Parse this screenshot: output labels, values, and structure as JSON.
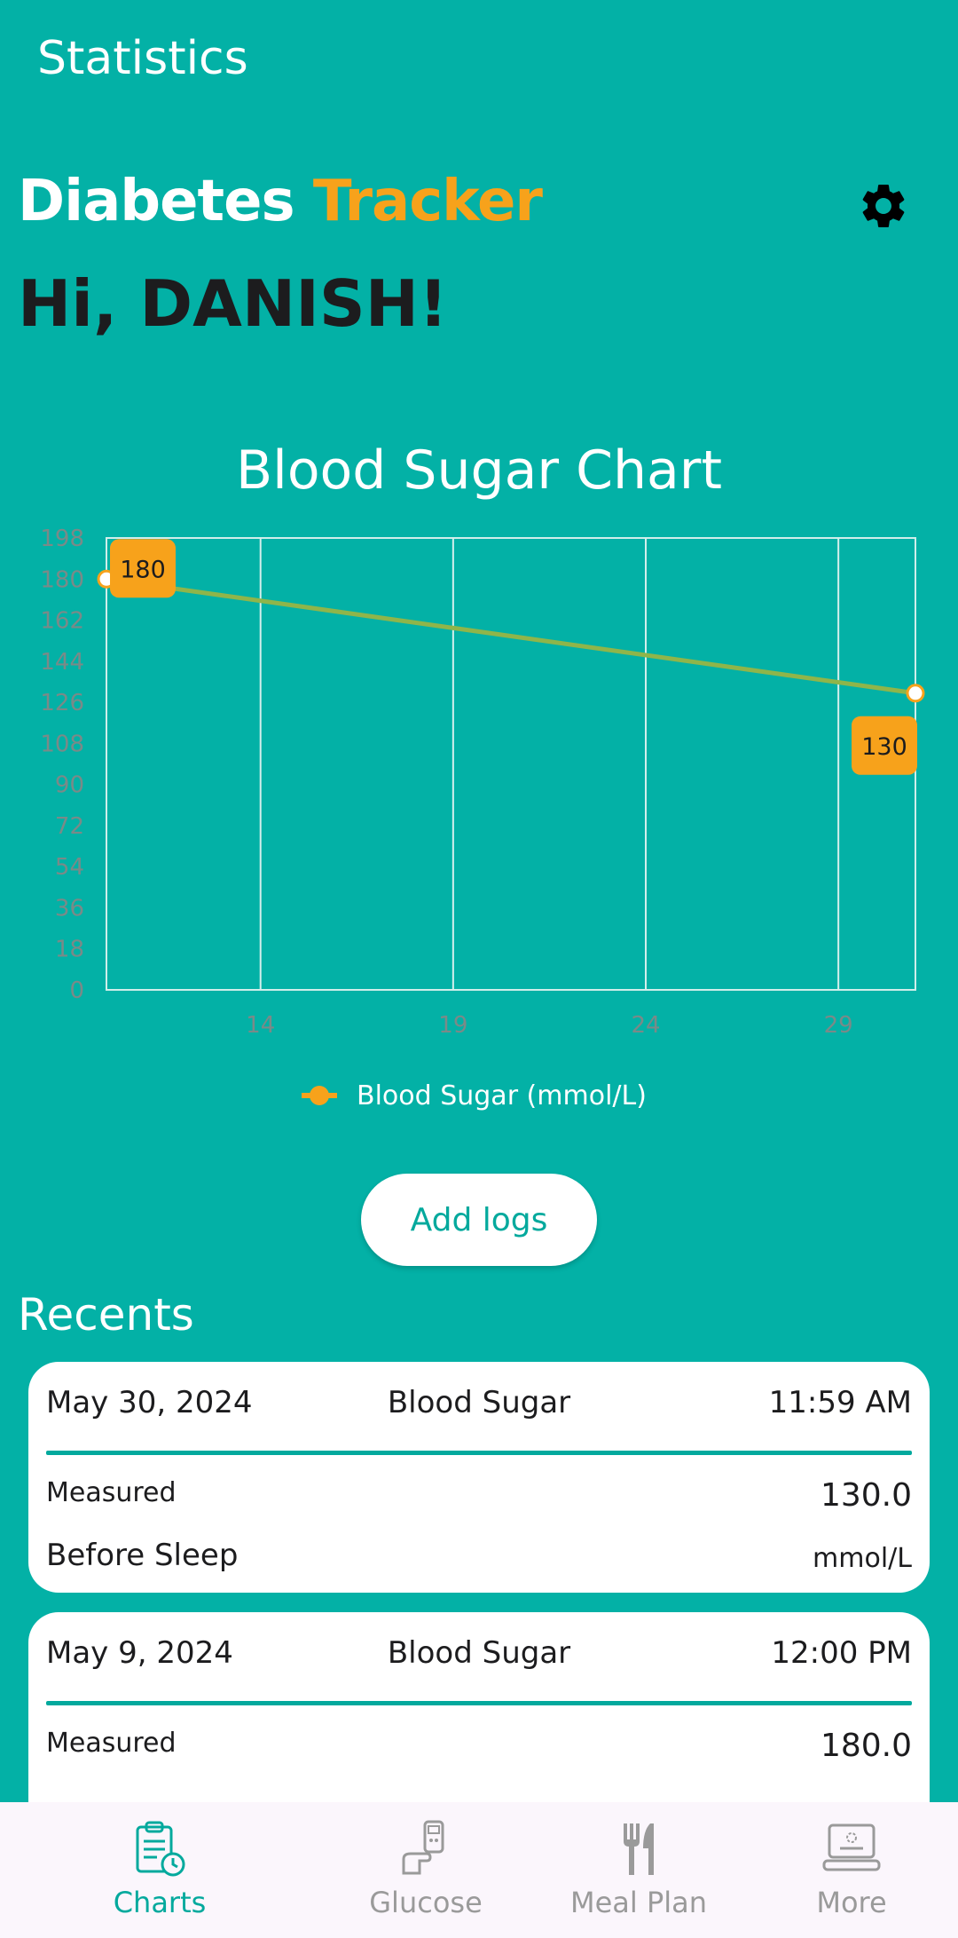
{
  "appbar": {
    "title": "Statistics"
  },
  "header": {
    "brand_part1": "Diabetes",
    "brand_part2": "Tracker",
    "greeting": "Hi, DANISH!",
    "settings_icon": "gear-icon"
  },
  "colors": {
    "background": "#03B1A6",
    "accent": "#F7A21B",
    "line": "#8FB54A",
    "primary": "#03A99D"
  },
  "chart_data": {
    "type": "line",
    "title": "Blood Sugar Chart",
    "x": [
      10,
      31
    ],
    "series": [
      {
        "name": "Blood Sugar (mmol/L)",
        "values": [
          180,
          130
        ]
      }
    ],
    "data_labels": [
      "180",
      "130"
    ],
    "xticks": [
      "14",
      "19",
      "24",
      "29"
    ],
    "yticks": [
      "0",
      "18",
      "36",
      "54",
      "72",
      "90",
      "108",
      "126",
      "144",
      "162",
      "180",
      "198"
    ],
    "ylim": [
      0,
      198
    ],
    "grid": true,
    "legend": "bottom"
  },
  "actions": {
    "add_logs": "Add logs"
  },
  "recents": {
    "title": "Recents",
    "items": [
      {
        "date": "May 30, 2024",
        "type": "Blood Sugar",
        "time": "11:59 AM",
        "measured_label": "Measured",
        "value": "130.0",
        "context": "Before Sleep",
        "unit": "mmol/L"
      },
      {
        "date": "May 9, 2024",
        "type": "Blood Sugar",
        "time": "12:00 PM",
        "measured_label": "Measured",
        "value": "180.0"
      }
    ]
  },
  "nav": {
    "items": [
      {
        "label": "Charts",
        "icon": "clipboard-clock-icon",
        "active": true
      },
      {
        "label": "Glucose",
        "icon": "glucose-meter-icon",
        "active": false
      },
      {
        "label": "Meal Plan",
        "icon": "fork-knife-icon",
        "active": false
      },
      {
        "label": "More",
        "icon": "laptop-icon",
        "active": false
      }
    ]
  }
}
